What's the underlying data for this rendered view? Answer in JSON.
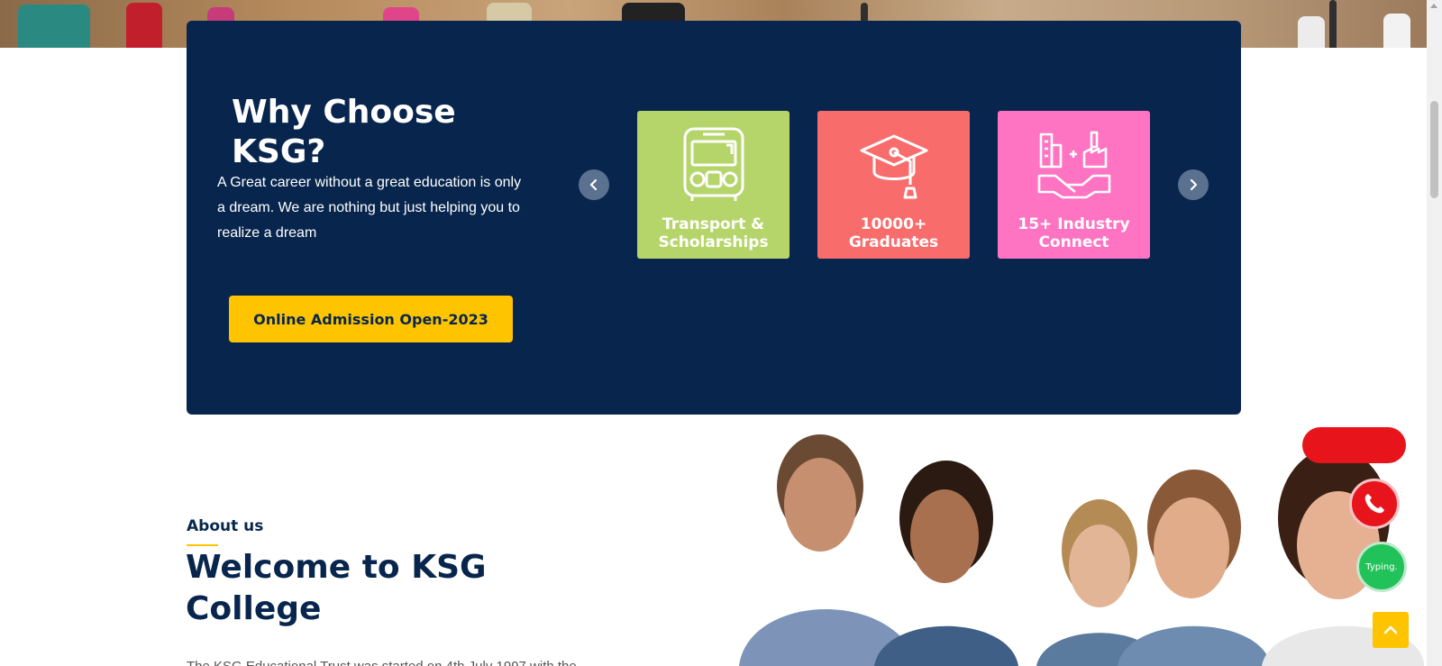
{
  "colors": {
    "panel_bg": "#08264d",
    "accent_yellow": "#ffc400",
    "card_green": "#b5d56a",
    "card_red": "#f96c6c",
    "card_pink": "#ff74c2",
    "widget_red": "#e8141c",
    "widget_green": "#22c25a"
  },
  "why": {
    "title": "Why Choose KSG?",
    "text": "A Great career without a great education is only a dream. We are nothing but just helping you to realize a dream",
    "button_label": "Online Admission Open-2023",
    "cards": [
      {
        "label": "Transport &\nScholarships",
        "icon": "bus-icon"
      },
      {
        "label": "10000+\nGraduates",
        "icon": "graduation-cap-icon"
      },
      {
        "label": "15+ Industry\nConnect",
        "icon": "industry-handshake-icon"
      }
    ]
  },
  "about": {
    "eyebrow": "About us",
    "title": "Welcome to KSG College",
    "text_partial": "The KSG Educational Trust was started on 4th July 1997 with the"
  },
  "widgets": {
    "chat_label": "Typing."
  }
}
